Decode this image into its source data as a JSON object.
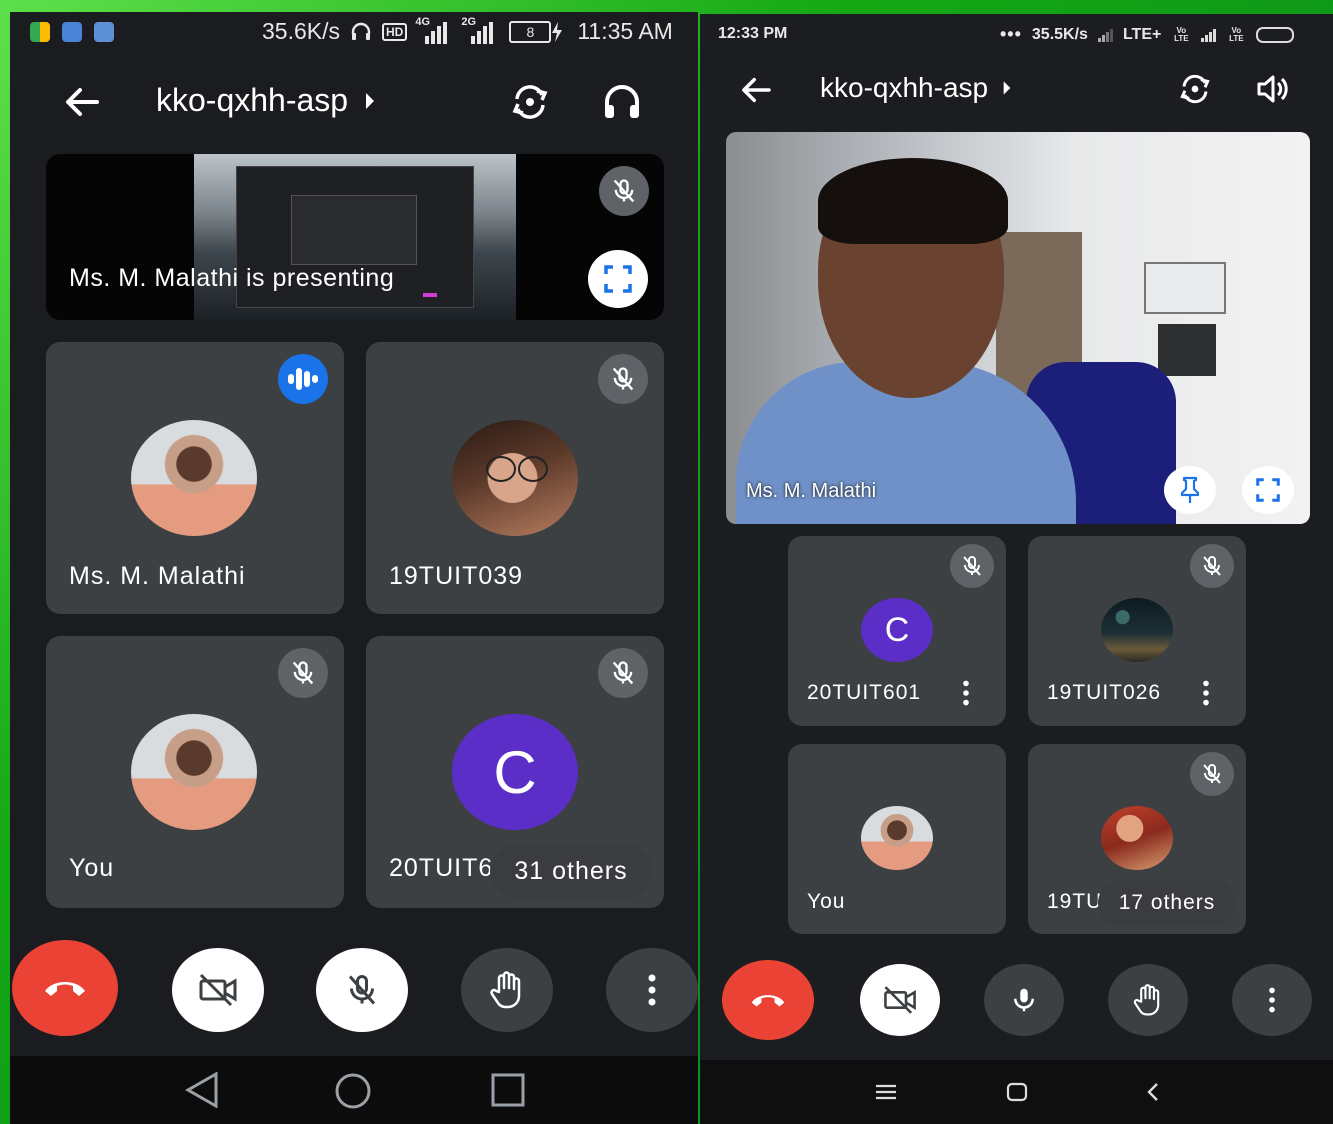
{
  "left": {
    "status": {
      "speed": "35.6K/s",
      "time": "11:35 AM",
      "battery": "8",
      "net_a": "4G",
      "net_b": "2G",
      "hd": "HD"
    },
    "meeting_code": "kko-qxhh-asp",
    "presenting_label": "Ms. M. Malathi is presenting",
    "tiles": [
      {
        "name": "Ms. M. Malathi"
      },
      {
        "name": "19TUIT039"
      },
      {
        "name": "You"
      },
      {
        "name": "20TUIT60",
        "initial": "C",
        "others": "31 others"
      }
    ]
  },
  "right": {
    "status": {
      "time": "12:33 PM",
      "speed": "35.5K/s",
      "net": "LTE+",
      "volte": "Vo LTE"
    },
    "meeting_code": "kko-qxhh-asp",
    "main_video_name": "Ms. M. Malathi",
    "tiles": [
      {
        "name": "20TUIT601",
        "initial": "C"
      },
      {
        "name": "19TUIT026"
      },
      {
        "name": "You"
      },
      {
        "name": "19TU",
        "others": "17 others"
      }
    ]
  },
  "colors": {
    "end_call": "#ea4335",
    "avatar_purple": "#5b2ec8",
    "speaking_blue": "#1a73e8"
  },
  "icons": [
    "back-arrow-icon",
    "caret-right-icon",
    "switch-camera-icon",
    "headphones-icon",
    "speaker-icon",
    "mic-off-icon",
    "fullscreen-icon",
    "pin-icon",
    "audio-level-icon",
    "end-call-icon",
    "camera-off-icon",
    "mic-icon",
    "raise-hand-icon",
    "more-vert-icon",
    "nav-back-icon",
    "nav-home-icon",
    "nav-recents-icon",
    "nav-menu-icon"
  ]
}
